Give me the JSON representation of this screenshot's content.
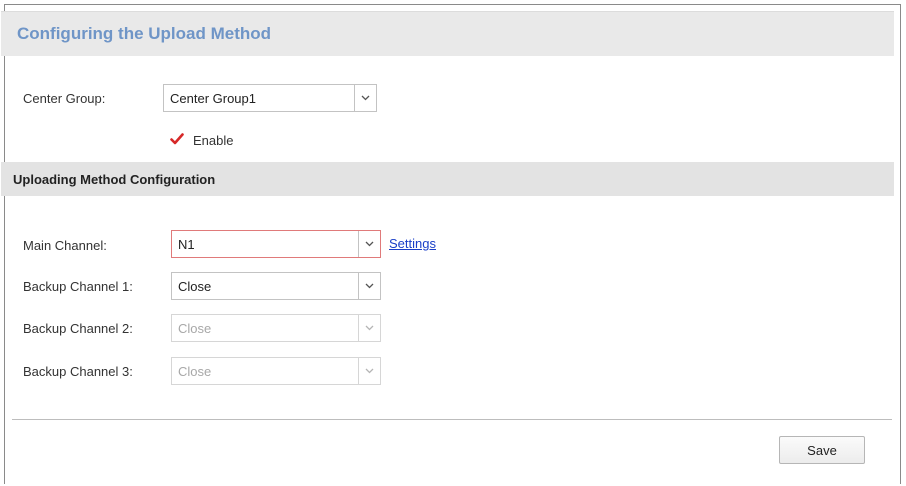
{
  "header": {
    "title": "Configuring the Upload Method"
  },
  "center_group": {
    "label": "Center Group:",
    "value": "Center Group1"
  },
  "enable": {
    "label": "Enable",
    "checked": true
  },
  "section": {
    "title": "Uploading Method Configuration"
  },
  "main_channel": {
    "label": "Main Channel:",
    "value": "N1",
    "settings_link": "Settings"
  },
  "backup1": {
    "label": "Backup Channel 1:",
    "value": "Close"
  },
  "backup2": {
    "label": "Backup Channel 2:",
    "value": "Close",
    "disabled": true
  },
  "backup3": {
    "label": "Backup Channel 3:",
    "value": "Close",
    "disabled": true
  },
  "actions": {
    "save_label": "Save"
  },
  "colors": {
    "title": "#6f95c7",
    "check": "#d62828",
    "link": "#1a3fc8",
    "focus_border": "#e07a7a"
  }
}
